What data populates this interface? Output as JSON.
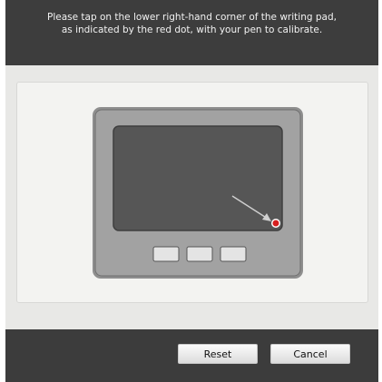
{
  "instruction": {
    "text": "Please tap on the lower right-hand corner of the writing pad,\nas indicated by the red dot, with your pen to calibrate."
  },
  "tablet": {
    "hardware_buttons": [
      "",
      "",
      ""
    ],
    "calibration_target": {
      "corner": "lower-right",
      "color": "#d61f1f"
    }
  },
  "footer": {
    "reset_label": "Reset",
    "cancel_label": "Cancel"
  },
  "colors": {
    "header_bg": "#3d3d3d",
    "footer_bg": "#3c3c3c",
    "tablet_body": "#9c9c9c",
    "screen": "#555555",
    "target_dot": "#d61f1f"
  }
}
